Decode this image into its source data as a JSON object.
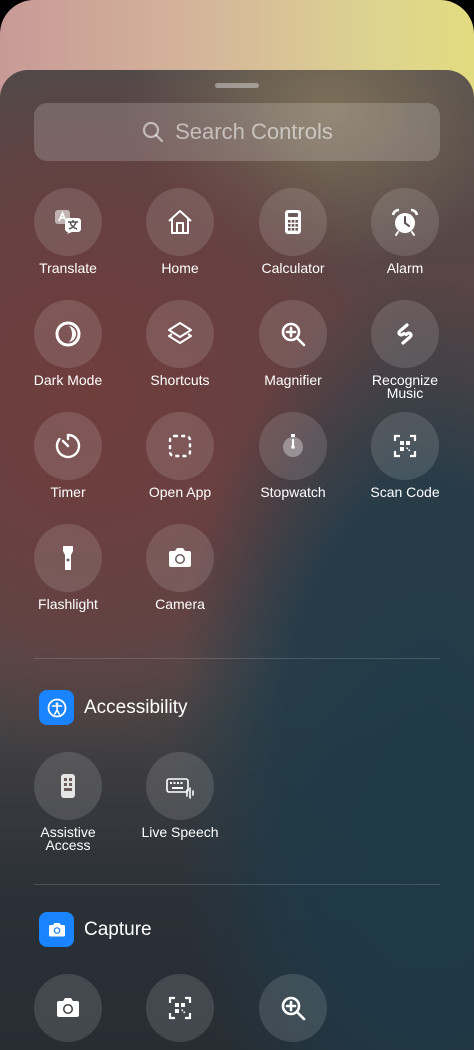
{
  "search": {
    "placeholder": "Search Controls",
    "icon": "search-icon"
  },
  "controls": [
    {
      "label": "Translate",
      "icon": "translate-icon"
    },
    {
      "label": "Home",
      "icon": "home-icon"
    },
    {
      "label": "Calculator",
      "icon": "calculator-icon"
    },
    {
      "label": "Alarm",
      "icon": "alarm-icon"
    },
    {
      "label": "Dark Mode",
      "icon": "dark-mode-icon"
    },
    {
      "label": "Shortcuts",
      "icon": "shortcuts-icon"
    },
    {
      "label": "Magnifier",
      "icon": "magnifier-icon"
    },
    {
      "label": "Recognize\nMusic",
      "icon": "shazam-icon"
    },
    {
      "label": "Timer",
      "icon": "timer-icon"
    },
    {
      "label": "Open App",
      "icon": "open-app-icon"
    },
    {
      "label": "Stopwatch",
      "icon": "stopwatch-icon"
    },
    {
      "label": "Scan Code",
      "icon": "scan-code-icon"
    },
    {
      "label": "Flashlight",
      "icon": "flashlight-icon"
    },
    {
      "label": "Camera",
      "icon": "camera-icon"
    }
  ],
  "sections": {
    "accessibility": {
      "title": "Accessibility",
      "icon": "accessibility-icon",
      "color": "#1a84ff",
      "controls": [
        {
          "label": "Assistive\nAccess",
          "icon": "assistive-access-icon"
        },
        {
          "label": "Live Speech",
          "icon": "live-speech-icon"
        }
      ]
    },
    "capture": {
      "title": "Capture",
      "icon": "camera-icon",
      "color": "#1a84ff",
      "controls": [
        {
          "icon": "camera-icon"
        },
        {
          "icon": "scan-code-icon"
        },
        {
          "icon": "magnifier-icon"
        }
      ]
    }
  }
}
